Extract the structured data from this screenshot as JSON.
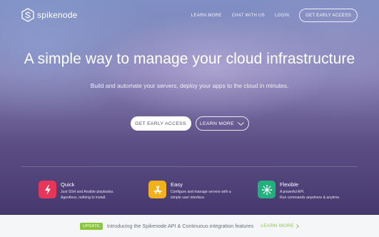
{
  "brand": {
    "name": "spikenode",
    "logo_icon": "spikenode-logo-icon"
  },
  "nav": {
    "links": [
      "LEARN MORE",
      "CHAT WITH US",
      "LOGIN"
    ],
    "cta": "GET EARLY ACCESS"
  },
  "hero": {
    "title": "A simple way to manage your cloud infrastructure",
    "subtitle": "Build and automate your servers, deploy your apps to the cloud in minutes.",
    "primary_button": "GET EARLY ACCESS",
    "secondary_button": "LEARN MORE"
  },
  "features": [
    {
      "title": "Quick",
      "desc_line1": "Just SSH and Ansible playbooks.",
      "desc_line2": "Agentless, nothing to install.",
      "icon": "lightning-icon",
      "color": "#e8355a"
    },
    {
      "title": "Easy",
      "desc_line1": "Configure and manage servers with a",
      "desc_line2": "simple user interface.",
      "icon": "app-store-icon",
      "color": "#f2b01e"
    },
    {
      "title": "Flexible",
      "desc_line1": "A powerful API.",
      "desc_line2": "Run commands anywhere & anytime.",
      "icon": "network-hub-icon",
      "color": "#22b07f"
    }
  ],
  "banner": {
    "badge": "UPDATE",
    "text": "Introducing the Spikenode API & Continuous integration features",
    "link": "LEARN MORE",
    "accent": "#8cc63f"
  }
}
